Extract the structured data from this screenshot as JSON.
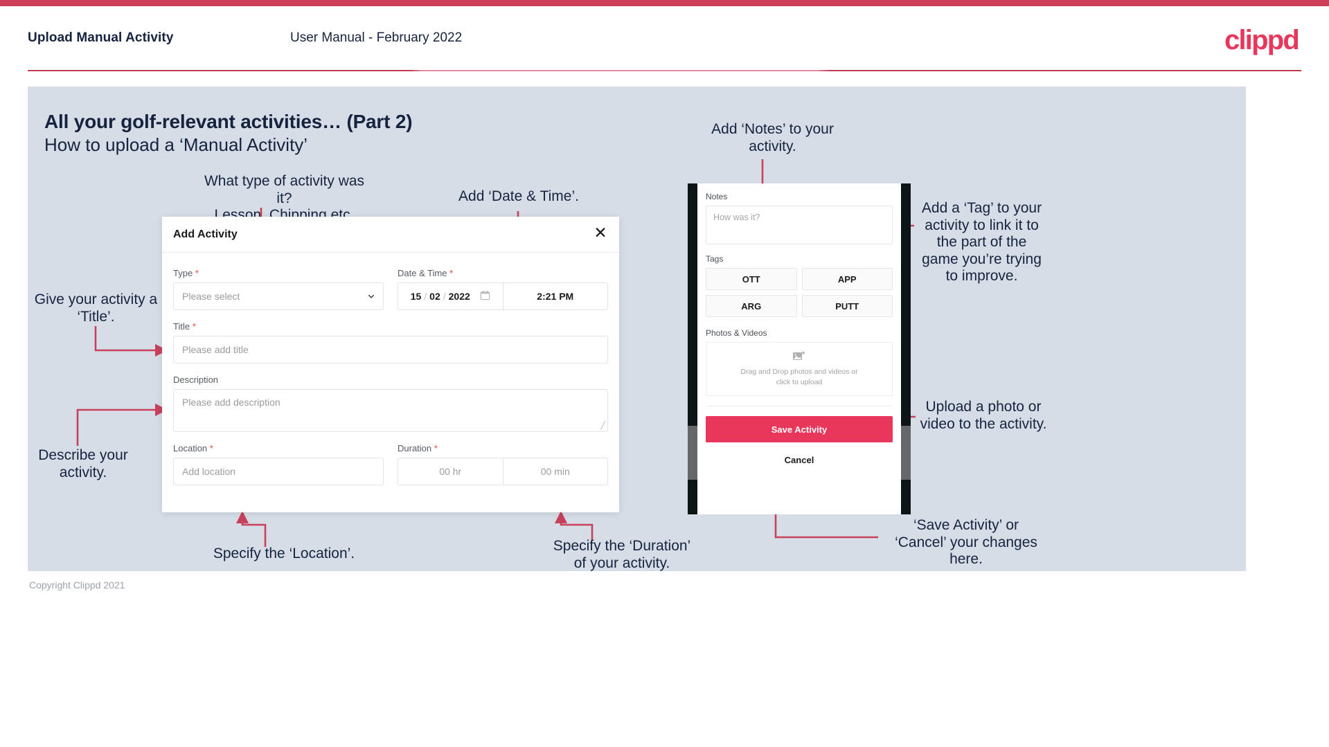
{
  "header": {
    "left_title": "Upload Manual Activity",
    "center_title": "User Manual - February 2022",
    "logo": "clippd"
  },
  "slide": {
    "title": "All your golf-relevant activities… (Part 2)",
    "subtitle": "How to upload a ‘Manual Activity’",
    "copyright": "Copyright Clippd 2021"
  },
  "annotations": {
    "type": "What type of activity was it?\nLesson, Chipping etc.",
    "date_time": "Add ‘Date & Time’.",
    "title": "Give your activity a\n‘Title’.",
    "description": "Describe your\nactivity.",
    "location": "Specify the ‘Location’.",
    "duration": "Specify the ‘Duration’\nof your activity.",
    "notes": "Add ‘Notes’ to your\nactivity.",
    "tags": "Add a ‘Tag’ to your\nactivity to link it to\nthe part of the\ngame you’re trying\nto improve.",
    "upload": "Upload a photo or\nvideo to the activity.",
    "save_cancel": "‘Save Activity’ or\n‘Cancel’ your changes\nhere."
  },
  "modal": {
    "title": "Add Activity",
    "close_icon": "close-icon",
    "fields": {
      "type": {
        "label": "Type",
        "required": "*",
        "placeholder": "Please select",
        "chevron_icon": "chevron-down-icon"
      },
      "date_time": {
        "label": "Date & Time",
        "required": "*",
        "day": "15",
        "sep1": "/",
        "month": "02",
        "sep2": "/",
        "year": "2022",
        "calendar_icon": "calendar-icon",
        "time": "2:21 PM"
      },
      "title": {
        "label": "Title",
        "required": "*",
        "placeholder": "Please add title"
      },
      "description": {
        "label": "Description",
        "placeholder": "Please add description"
      },
      "location": {
        "label": "Location",
        "required": "*",
        "placeholder": "Add location"
      },
      "duration": {
        "label": "Duration",
        "required": "*",
        "hours_placeholder": "00 hr",
        "minutes_placeholder": "00 min"
      }
    }
  },
  "phone": {
    "notes_label": "Notes",
    "notes_placeholder": "How was it?",
    "tags_label": "Tags",
    "tags": [
      "OTT",
      "APP",
      "ARG",
      "PUTT"
    ],
    "photos_label": "Photos & Videos",
    "drop_icon": "add-image-icon",
    "drop_text": "Drag and Drop photos and videos or\nclick to upload",
    "save_label": "Save Activity",
    "cancel_label": "Cancel"
  },
  "colors": {
    "accent_pink": "#e8375a",
    "header_strip": "#cc3f57",
    "slide_bg": "#d6dde6",
    "text_dark": "#16233f",
    "arrow": "#c8415c"
  }
}
